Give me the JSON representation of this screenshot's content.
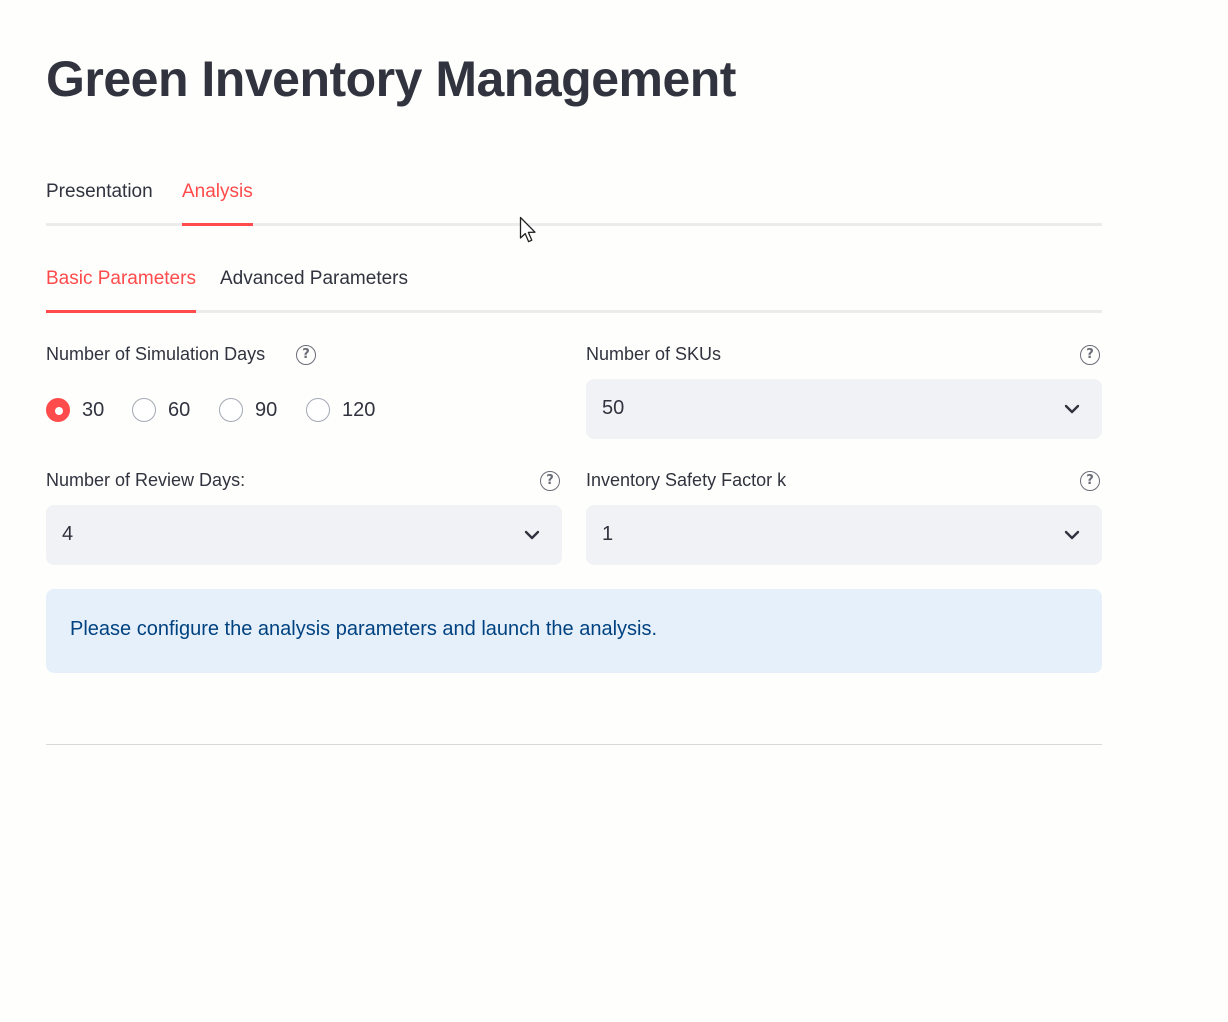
{
  "app": {
    "title": "Green Inventory Management"
  },
  "main_tabs": [
    {
      "label": "Presentation",
      "active": false
    },
    {
      "label": "Analysis",
      "active": true
    }
  ],
  "sub_tabs": [
    {
      "label": "Basic Parameters",
      "active": true
    },
    {
      "label": "Advanced Parameters",
      "active": false
    }
  ],
  "simulation_days": {
    "label": "Number of Simulation Days",
    "options": [
      "30",
      "60",
      "90",
      "120"
    ],
    "selected": "30"
  },
  "skus": {
    "label": "Number of SKUs",
    "value": "50"
  },
  "review_days": {
    "label": "Number of Review Days:",
    "value": "4"
  },
  "safety_factor": {
    "label": "Inventory Safety Factor k",
    "value": "1"
  },
  "info": {
    "message": "Please configure the analysis parameters and launch the analysis."
  },
  "icons": {
    "help": "question-circle-icon",
    "dropdown": "chevron-down-icon",
    "cursor": "mouse-pointer-icon"
  },
  "colors": {
    "accent": "#ff4b4b",
    "text": "#31333f",
    "select_bg": "#f0f2f6",
    "info_bg": "#e6f0fb",
    "info_text": "#004280"
  }
}
